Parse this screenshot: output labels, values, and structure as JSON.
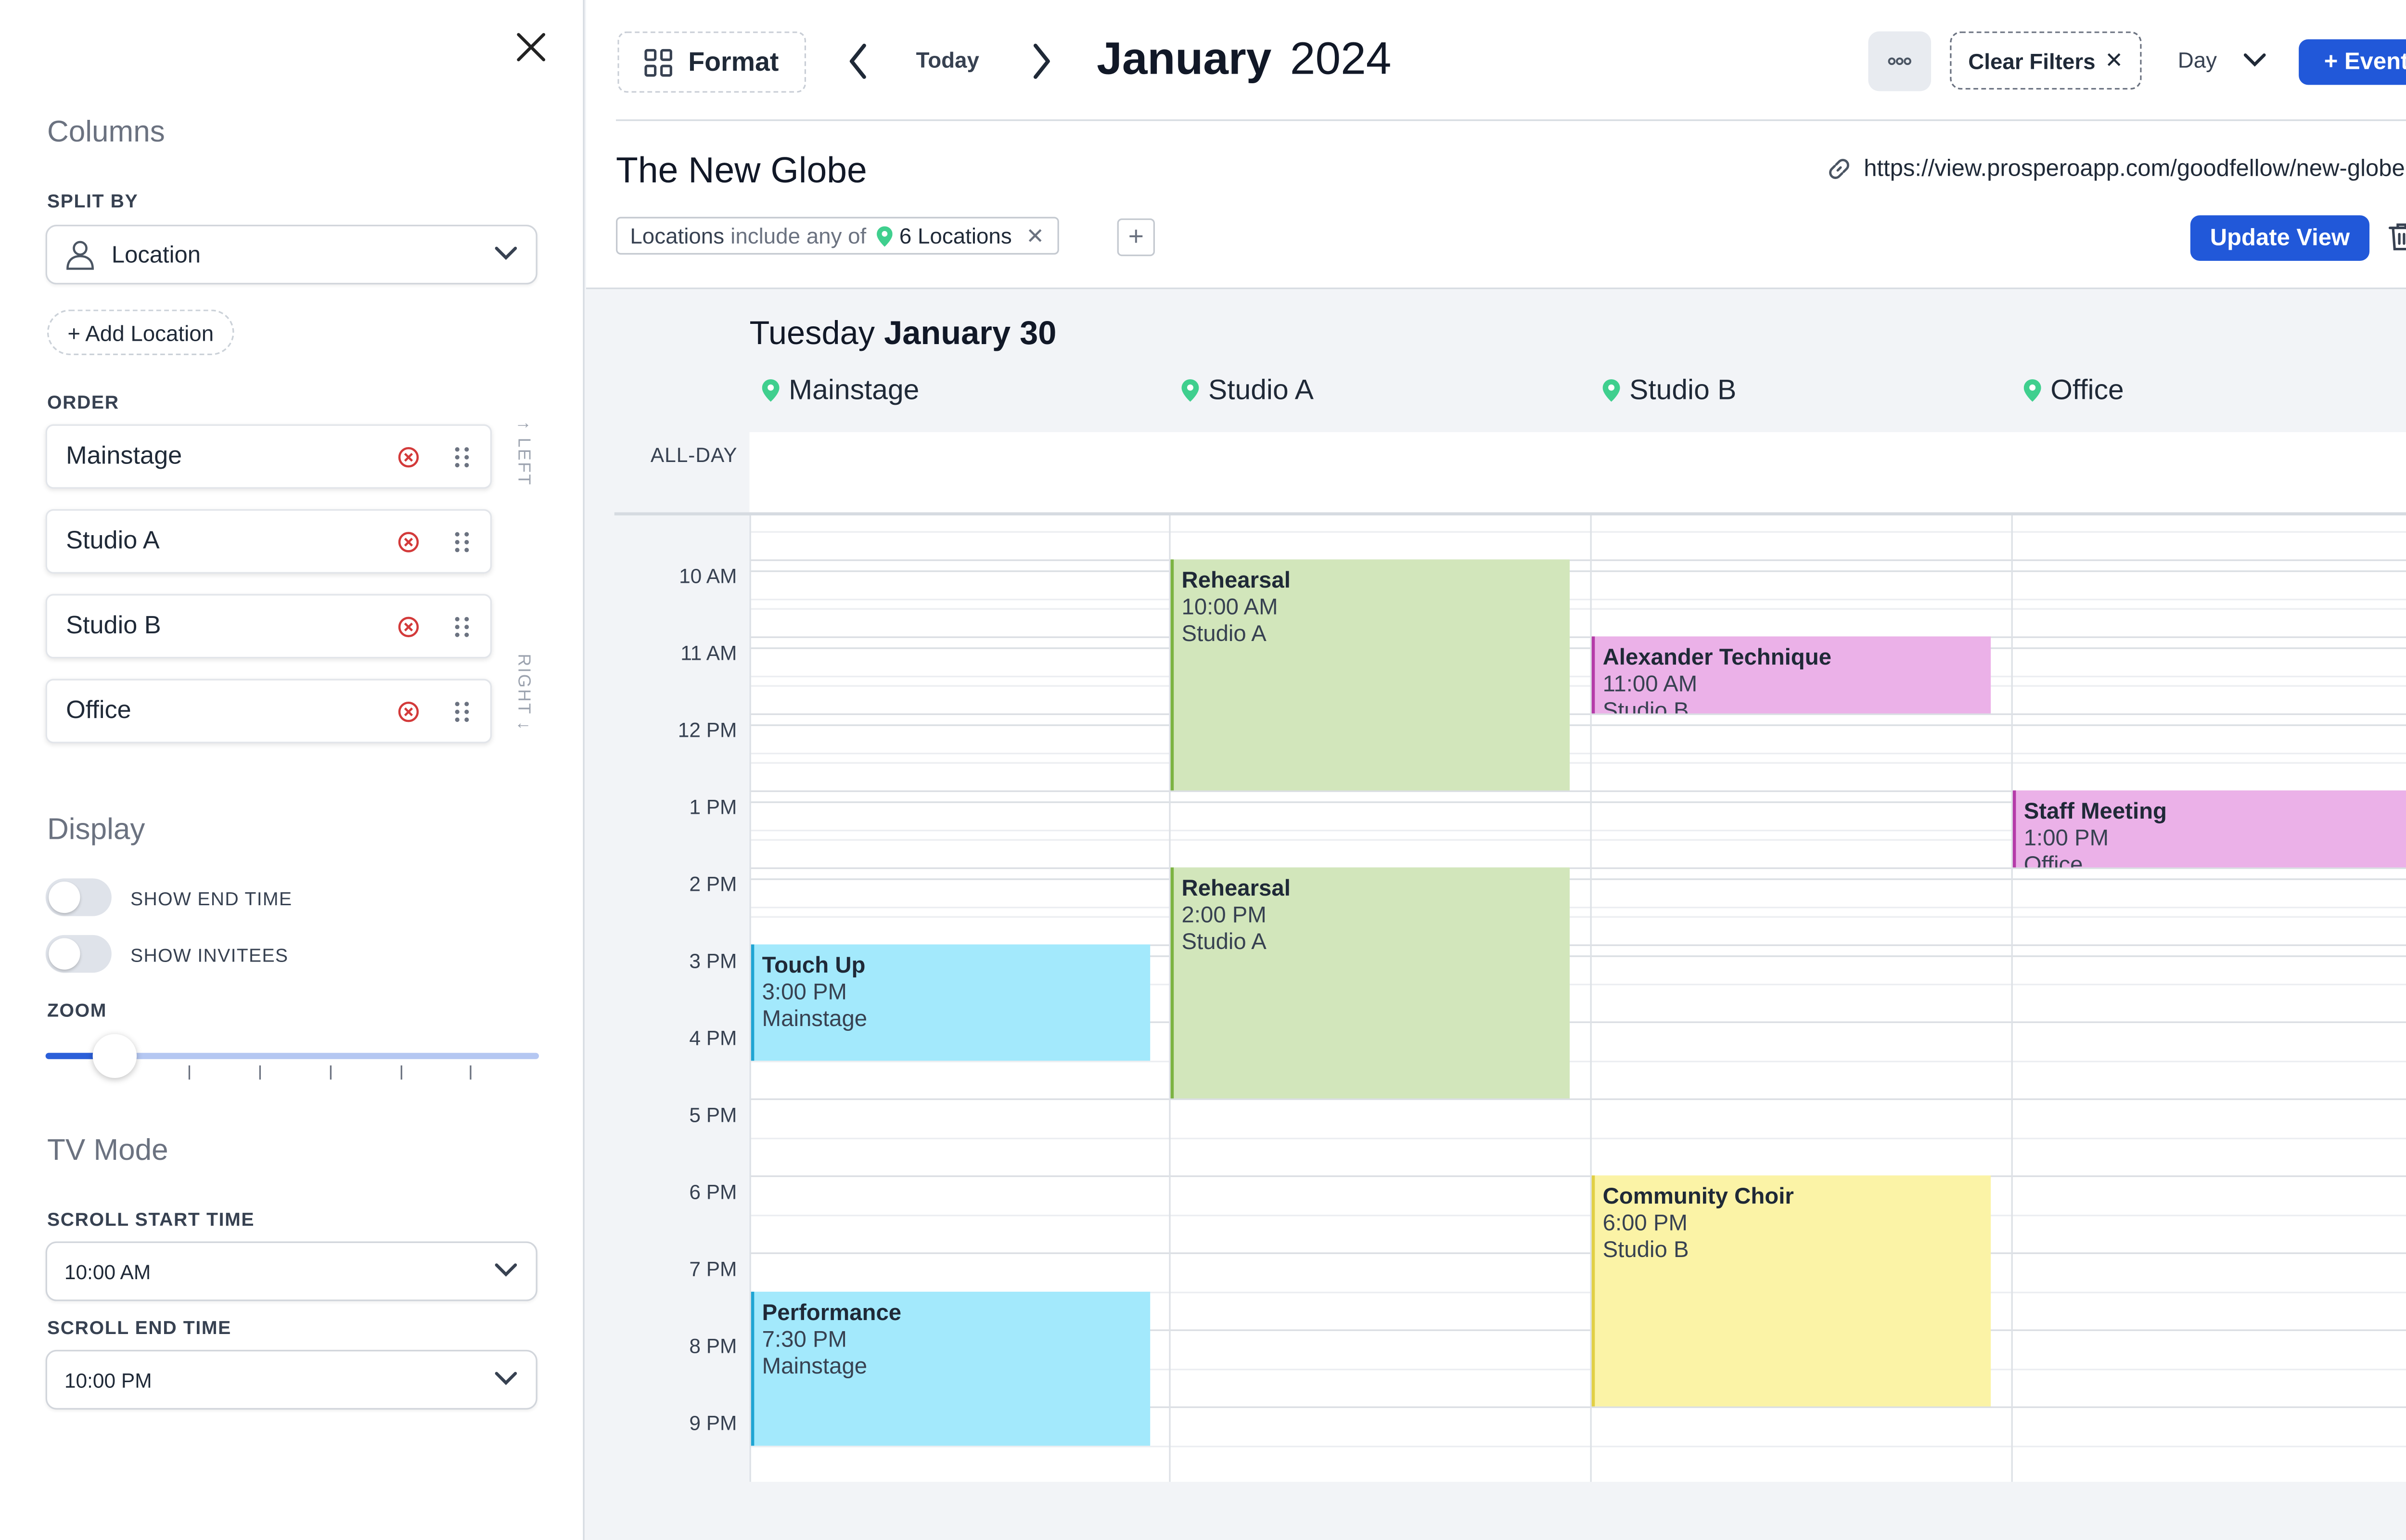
{
  "sidebar": {
    "columns_heading": "Columns",
    "split_by_label": "SPLIT BY",
    "split_by_value": "Location",
    "add_location": "+ Add Location",
    "order_label": "ORDER",
    "order_items": [
      "Mainstage",
      "Studio A",
      "Studio B",
      "Office"
    ],
    "hint_left": "↑ LEFT",
    "hint_right": "RIGHT ↓",
    "display_heading": "Display",
    "show_end_time": "SHOW END TIME",
    "show_invitees": "SHOW INVITEES",
    "zoom_label": "ZOOM",
    "zoom_level": 0.14,
    "tv_heading": "TV Mode",
    "scroll_start_label": "SCROLL START TIME",
    "scroll_start_value": "10:00 AM",
    "scroll_end_label": "SCROLL END TIME",
    "scroll_end_value": "10:00 PM"
  },
  "header": {
    "format": "Format",
    "today": "Today",
    "month": "January",
    "year": "2024",
    "clear_filters": "Clear Filters",
    "view_mode": "Day",
    "event_button": "+ Event",
    "view_title": "The New Globe",
    "url": "https://view.prosperoapp.com/goodfellow/new-globe",
    "filter_field": "Locations",
    "filter_op": "include any of",
    "filter_value": "6 Locations",
    "update_view": "Update View"
  },
  "calendar": {
    "weekday": "Tuesday",
    "date": "January 30",
    "all_day_label": "ALL-DAY",
    "columns": [
      "Mainstage",
      "Studio A",
      "Studio B",
      "Office"
    ],
    "time_labels": [
      "10 AM",
      "11 AM",
      "12 PM",
      "1 PM",
      "2 PM",
      "3 PM",
      "4 PM",
      "5 PM",
      "6 PM",
      "7 PM",
      "8 PM",
      "9 PM"
    ],
    "events": [
      {
        "title": "Rehearsal",
        "time": "10:00 AM",
        "location": "Studio A"
      },
      {
        "title": "Alexander Technique",
        "time": "11:00 AM",
        "location": "Studio B"
      },
      {
        "title": "Staff Meeting",
        "time": "1:00 PM",
        "location": "Office"
      },
      {
        "title": "Rehearsal",
        "time": "2:00 PM",
        "location": "Studio A"
      },
      {
        "title": "Touch Up",
        "time": "3:00 PM",
        "location": "Mainstage"
      },
      {
        "title": "Community Choir",
        "time": "6:00 PM",
        "location": "Studio B"
      },
      {
        "title": "Performance",
        "time": "7:30 PM",
        "location": "Mainstage"
      }
    ]
  },
  "colors": {
    "accent": "#2158d9",
    "event_green": "#d2e6bb",
    "event_pink": "#ebb1e8",
    "event_blue": "#a3e9fc",
    "event_yellow": "#fbf3a6",
    "remove_red": "#d33a3a",
    "pin_green": "#3fcf8e"
  },
  "icons": {
    "close": "close-icon",
    "format": "grid-icon",
    "more": "more-dots-icon",
    "link": "link-icon",
    "pin": "location-pin-icon",
    "trash": "trash-icon",
    "grip": "drag-handle-icon",
    "remove": "remove-circle-icon"
  }
}
